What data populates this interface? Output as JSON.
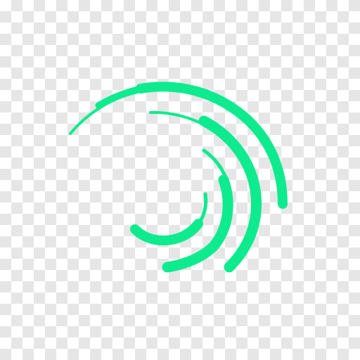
{
  "logo": {
    "icon": "swirl-arcs-logo-icon",
    "color": "#0DEB8E",
    "arcs": [
      "outer",
      "middle",
      "inner"
    ]
  }
}
